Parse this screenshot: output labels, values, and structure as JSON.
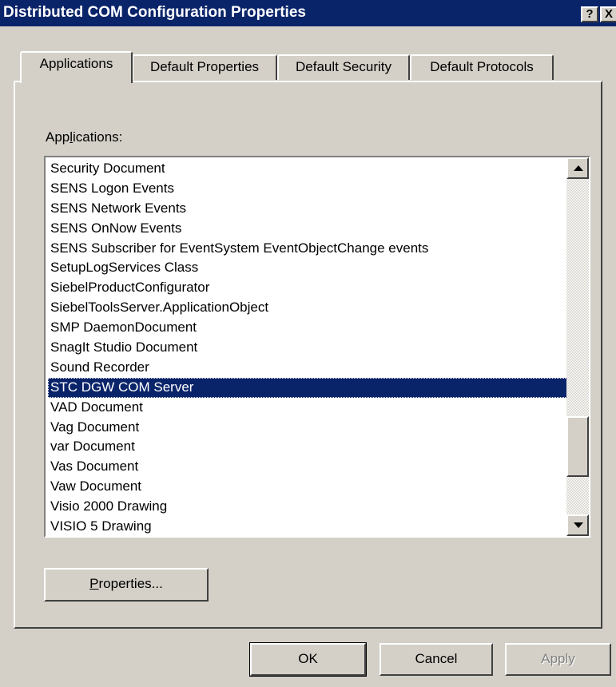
{
  "window": {
    "title": "Distributed COM Configuration Properties",
    "help_button": "?",
    "close_button": "X"
  },
  "tabs": [
    {
      "label": "Applications",
      "active": true
    },
    {
      "label": "Default Properties",
      "active": false
    },
    {
      "label": "Default Security",
      "active": false
    },
    {
      "label": "Default Protocols",
      "active": false
    }
  ],
  "applications": {
    "label_prefix": "App",
    "label_mnemonic": "l",
    "label_suffix": "ications:",
    "items": [
      "Security Document",
      "SENS Logon Events",
      "SENS Network Events",
      "SENS OnNow Events",
      "SENS Subscriber for EventSystem EventObjectChange events",
      "SetupLogServices Class",
      "SiebelProductConfigurator",
      "SiebelToolsServer.ApplicationObject",
      "SMP DaemonDocument",
      "SnagIt Studio Document",
      "Sound Recorder",
      "STC DGW COM Server",
      "VAD Document",
      "Vag Document",
      "var Document",
      "Vas Document",
      "Vaw Document",
      "Visio 2000 Drawing",
      "VISIO 5 Drawing"
    ],
    "selected_item": "STC DGW COM Server"
  },
  "buttons": {
    "properties_mnemonic": "P",
    "properties_rest": "roperties...",
    "ok": "OK",
    "cancel": "Cancel",
    "apply": "Apply"
  },
  "colors": {
    "titlebar": "#0a246a",
    "selection": "#0a246a",
    "face": "#d4d0c8"
  }
}
